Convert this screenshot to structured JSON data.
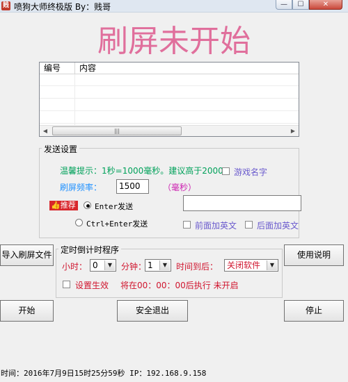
{
  "window": {
    "title": "喷狗大师终极版 By：贱哥",
    "icon_text": "贱",
    "min_glyph": "—",
    "max_glyph": "☐",
    "close_glyph": "✕"
  },
  "headline": "刷屏未开始",
  "list": {
    "columns": [
      "编号",
      "内容"
    ],
    "scroll_left_glyph": "◀",
    "scroll_thumb_glyph": "|||",
    "scroll_right_glyph": "▶"
  },
  "send_settings": {
    "legend": "发送设置",
    "tip": "温馨提示：1秒=1000毫秒。建议高于2000",
    "game_name_label": "游戏名字",
    "frequency_label": "刷屏频率：",
    "frequency_value": "1500",
    "ms_label": "（毫秒）",
    "recommend_badge": "👍推荐",
    "enter_label": "Enter发送",
    "ctrl_enter_label": "Ctrl+Enter发送",
    "prefix_english_label": "前面加英文",
    "suffix_english_label": "后面加英文",
    "enter_selected": true
  },
  "buttons": {
    "import": "导入刷屏文件",
    "help": "使用说明",
    "start": "开始",
    "exit": "安全退出",
    "stop": "停止"
  },
  "timer": {
    "legend": "定时倒计时程序",
    "hour_label": "小时：",
    "hour_value": "0",
    "minute_label": "分钟：",
    "minute_value": "1",
    "timeup_label": "时间到后：",
    "action_value": "关闭软件",
    "enable_label": "设置生效",
    "schedule_text": "将在00：00：00后执行 未开启",
    "dropdown_glyph": "▼"
  },
  "status_line": "时间：2016年7月9日15时25分59秒  IP：192.168.9.158",
  "colors": {
    "headline": "#e06f9c",
    "tip": "#00a15a",
    "frequency_label": "#1e90ff",
    "ms_label": "#cc1fb0",
    "timer_text": "#d0152e",
    "option_text": "#6a5acd"
  }
}
